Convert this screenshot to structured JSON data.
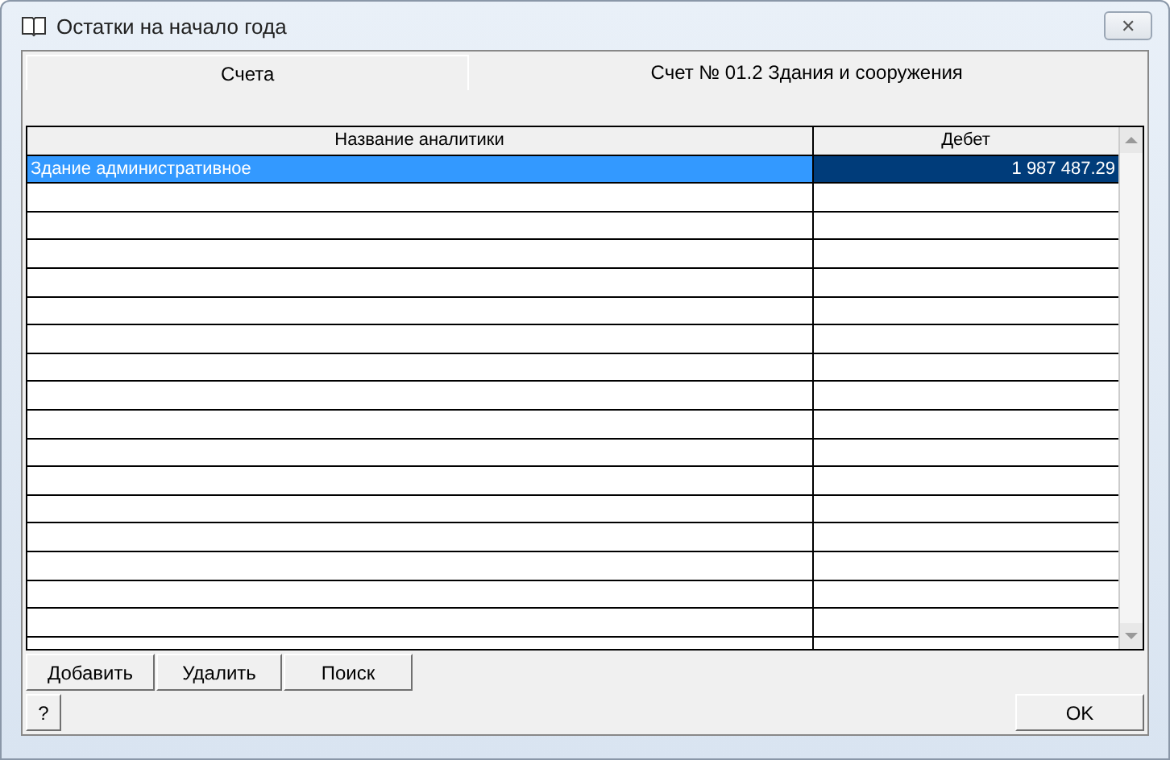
{
  "window": {
    "title": "Остатки на начало года",
    "close": "✕"
  },
  "tabs": [
    {
      "label": "Счета",
      "selected": false
    },
    {
      "label": "Счет № 01.2  Здания и сооружения",
      "selected": true
    }
  ],
  "table": {
    "columns": [
      "Название аналитики",
      "Дебет"
    ],
    "rows": [
      {
        "name": "Здание административное",
        "debit": "1 987 487.29",
        "selected": true
      }
    ]
  },
  "actions": [
    "Добавить",
    "Удалить",
    "Поиск"
  ],
  "help": "?",
  "ok": "OK"
}
